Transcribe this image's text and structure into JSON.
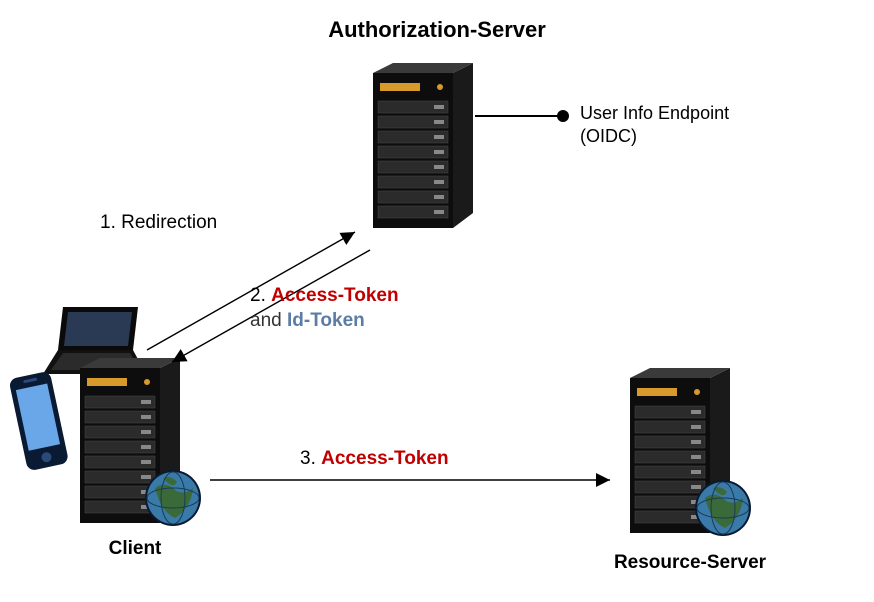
{
  "title": "Authorization-Server",
  "endpoint": {
    "line1": "User Info Endpoint",
    "line2": "(OIDC)"
  },
  "client_label": "Client",
  "resource_label": "Resource-Server",
  "step1": {
    "num": "1.",
    "text": "Redirection"
  },
  "step2": {
    "num": "2.",
    "access": "Access-Token",
    "and": "and",
    "id": "Id-Token"
  },
  "step3": {
    "num": "3.",
    "access": "Access-Token"
  }
}
